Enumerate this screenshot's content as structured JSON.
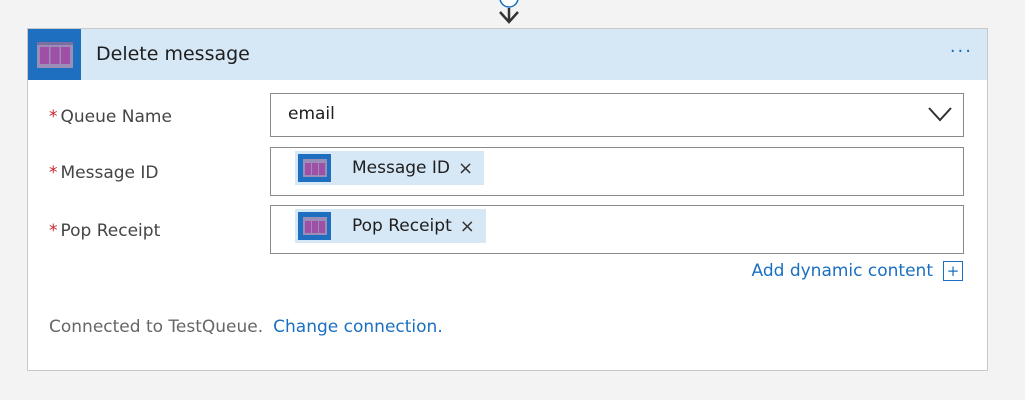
{
  "connector": {
    "icon": "arrow-down-icon"
  },
  "header": {
    "title": "Delete message",
    "icon": "storage-queue-icon",
    "menu": "···",
    "accent": "#1f6fc0",
    "header_bg": "#d6e7f5"
  },
  "fields": {
    "queue_name": {
      "required": "*",
      "label": "Queue Name",
      "value": "email"
    },
    "message_id": {
      "required": "*",
      "label": "Message ID",
      "token": "Message ID",
      "remove": "×"
    },
    "pop_receipt": {
      "required": "*",
      "label": "Pop Receipt",
      "token": "Pop Receipt",
      "remove": "×"
    }
  },
  "add_dynamic": {
    "label": "Add dynamic content",
    "icon": "plus-icon",
    "plus": "+"
  },
  "footer": {
    "connected": "Connected to TestQueue.",
    "change": "Change connection."
  }
}
